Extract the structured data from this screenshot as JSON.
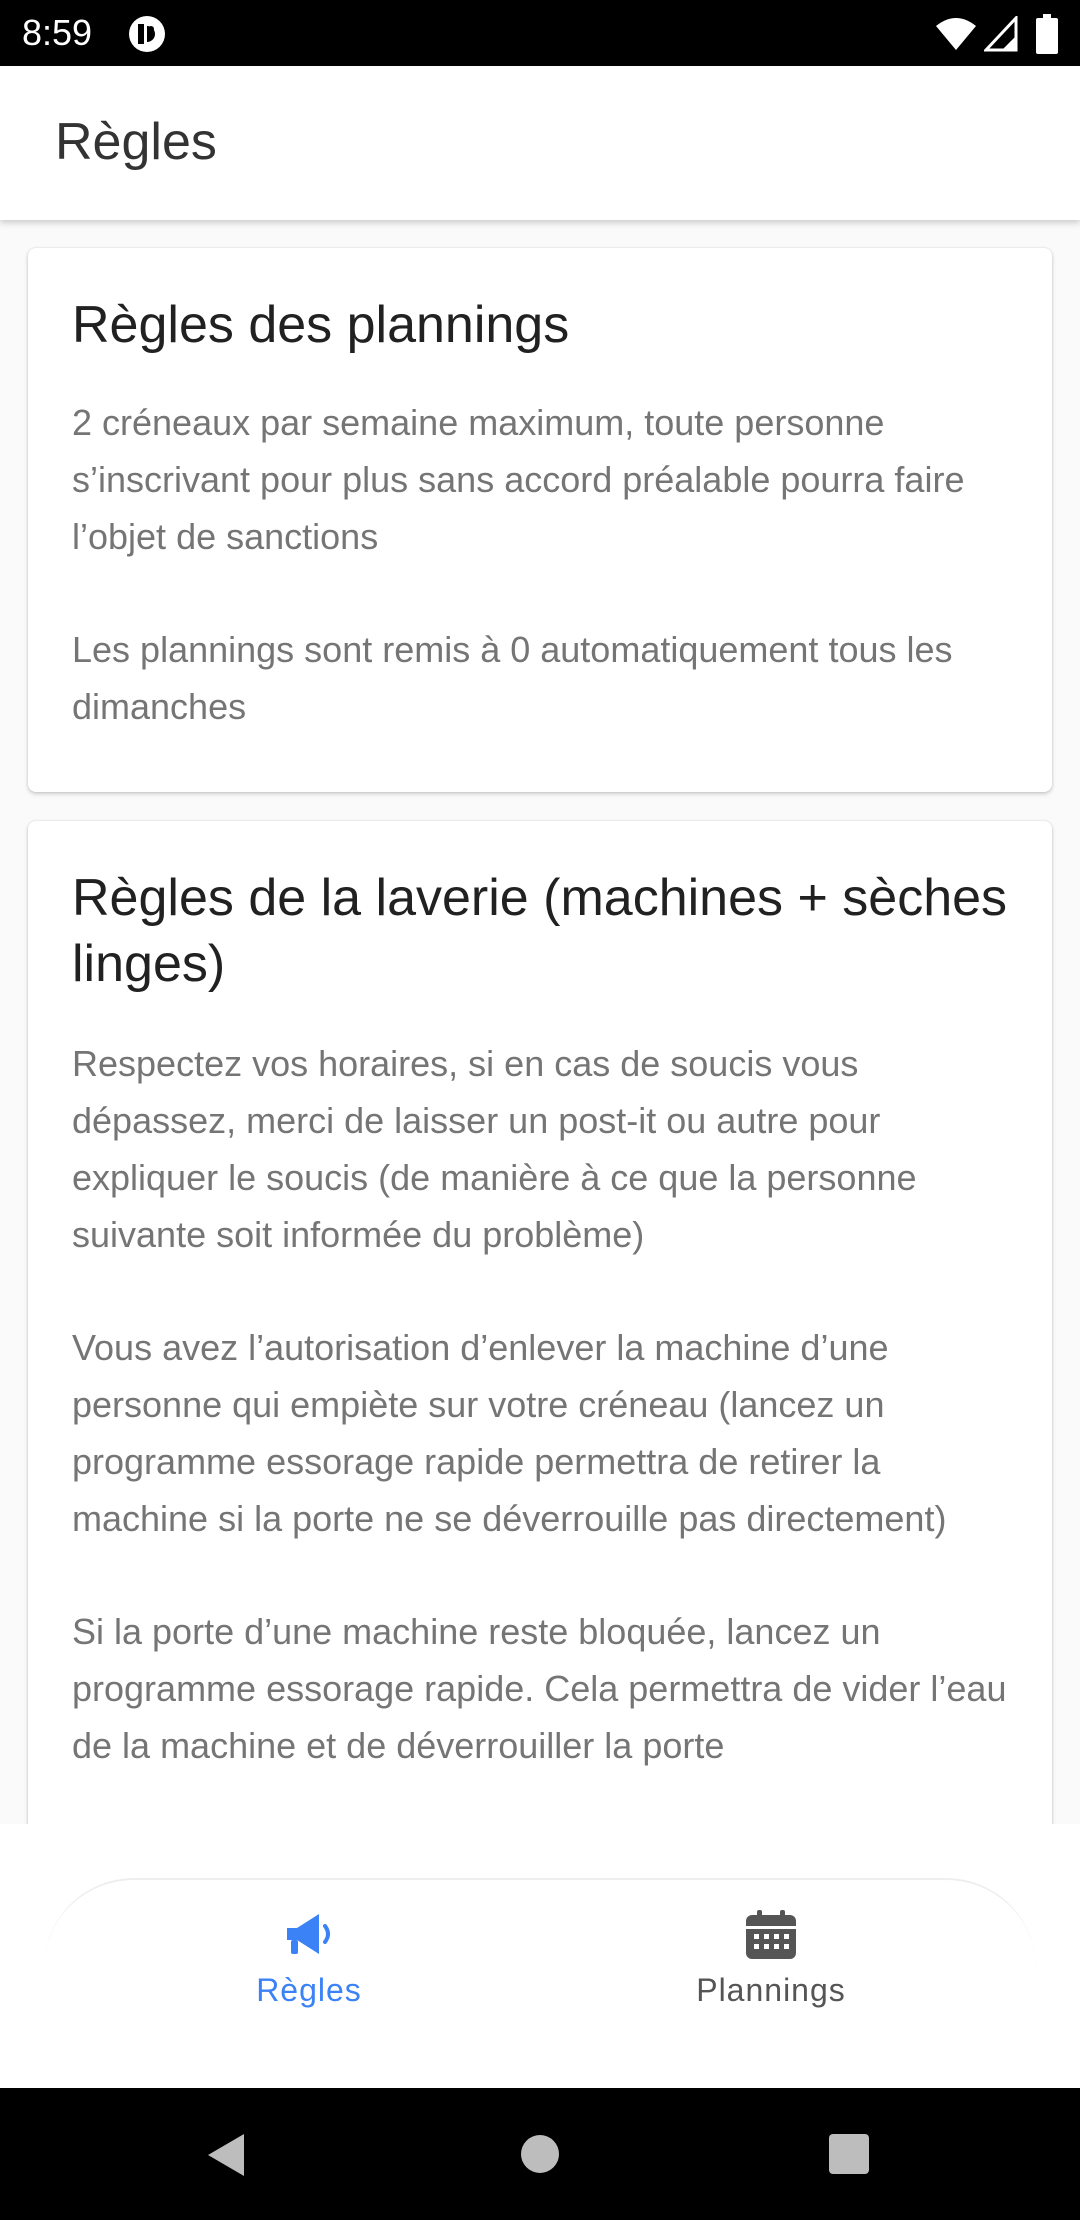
{
  "status_bar": {
    "time": "8:59",
    "icons": [
      "app-notification-icon",
      "wifi-icon",
      "signal-icon",
      "battery-icon"
    ]
  },
  "app_bar": {
    "title": "Règles"
  },
  "cards": [
    {
      "title": "Règles des plannings",
      "paragraphs": [
        "2 créneaux par semaine maximum, toute personne s’inscrivant pour plus sans accord préalable pourra faire l’objet de sanctions",
        "Les plannings sont remis à 0 automatiquement tous les dimanches"
      ]
    },
    {
      "title": "Règles de la laverie (machines + sèches linges)",
      "paragraphs": [
        "Respectez vos horaires, si en cas de soucis vous dépassez, merci de laisser un post-it ou autre pour expliquer le soucis (de manière à ce que la personne suivante soit informée du problème)",
        "Vous avez l’autorisation d’enlever la machine d’une personne qui empiète sur votre créneau (lancez un programme essorage rapide permettra de retirer la machine si la porte ne se déverrouille pas directement)",
        "Si la porte d’une machine reste bloquée, lancez un programme essorage rapide. Cela permettra de vider l’eau de la machine et de déverrouiller la porte"
      ]
    }
  ],
  "bottom_nav": {
    "items": [
      {
        "label": "Règles",
        "icon": "megaphone-icon",
        "active": true
      },
      {
        "label": "Plannings",
        "icon": "calendar-icon",
        "active": false
      }
    ],
    "active_color": "#3b82f6"
  },
  "system_nav": {
    "icons": [
      "back-icon",
      "home-icon",
      "recents-icon"
    ]
  }
}
